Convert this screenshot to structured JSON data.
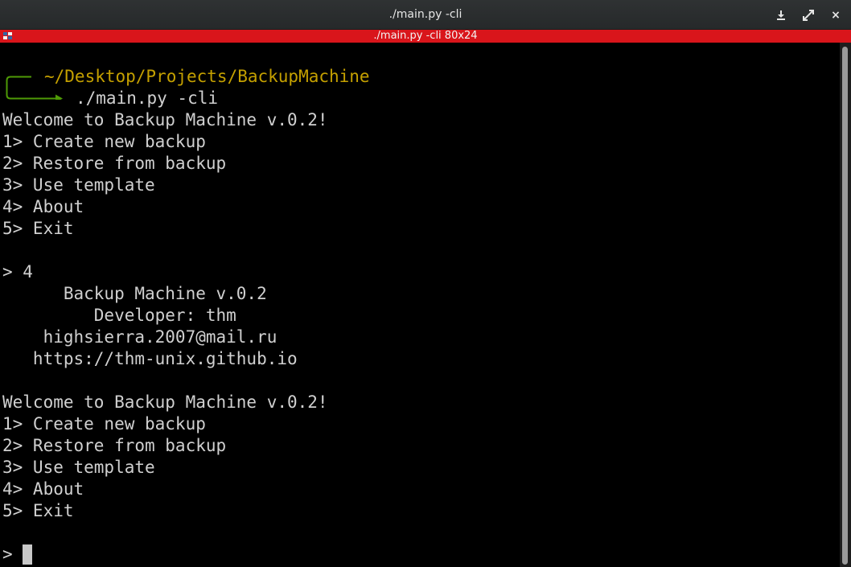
{
  "window": {
    "title": "./main.py -cli",
    "minimize_icon": "download-arrow-icon",
    "maximize_icon": "expand-arrows-icon",
    "close_symbol": "×"
  },
  "tab": {
    "title": "./main.py -cli 80x24",
    "icon": "tile-grid-icon",
    "accent_color": "#d9151b"
  },
  "terminal": {
    "prompt_path": "~/Desktop/Projects/BackupMachine",
    "command": "./main.py -cli",
    "path_color": "#c4a000",
    "arrow_color": "#4e9a06",
    "lines": [
      "Welcome to Backup Machine v.0.2!",
      "1> Create new backup",
      "2> Restore from backup",
      "3> Use template",
      "4> About",
      "5> Exit",
      "",
      "> 4",
      "      Backup Machine v.0.2",
      "         Developer: thm",
      "    highsierra.2007@mail.ru",
      "   https://thm-unix.github.io",
      "",
      "Welcome to Backup Machine v.0.2!",
      "1> Create new backup",
      "2> Restore from backup",
      "3> Use template",
      "4> About",
      "5> Exit",
      "",
      "> "
    ]
  }
}
